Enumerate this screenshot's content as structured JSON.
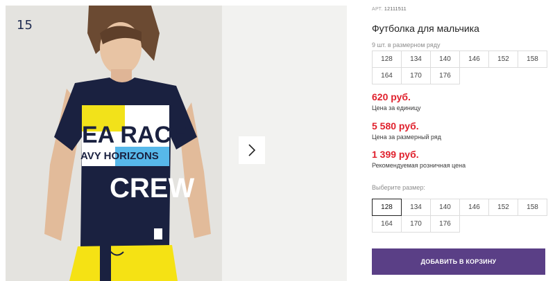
{
  "gallery": {
    "index_number": "15",
    "print_text": {
      "line1": "EA RACE",
      "line2": "AVY HORIZONS",
      "line3": "CREW"
    }
  },
  "product": {
    "art_label": "АРТ.",
    "art_value": "12111511",
    "title": "Футболка для мальчика",
    "row_note": "9 шт. в размерном ряду",
    "size_row": [
      "128",
      "134",
      "140",
      "146",
      "152",
      "158",
      "164",
      "170",
      "176"
    ]
  },
  "prices": {
    "unit_price": "620 руб.",
    "unit_caption": "Цена за единицу",
    "row_price": "5 580 руб.",
    "row_caption": "Цена за размерный ряд",
    "retail_price": "1 399 руб.",
    "retail_caption": "Рекомендуемая розничная цена"
  },
  "size_select": {
    "label": "Выберите размер:",
    "options": [
      "128",
      "134",
      "140",
      "146",
      "152",
      "158",
      "164",
      "170",
      "176"
    ],
    "selected": "128"
  },
  "cart_button": {
    "label": "ДОБАВИТЬ В КОРЗИНУ"
  },
  "colors": {
    "price_red": "#e0212d",
    "button_purple": "#5a3f86",
    "tshirt_navy": "#1a2140",
    "shorts_yellow": "#f5e214",
    "print_yellow": "#f2e21a",
    "print_blue": "#57b8ea"
  }
}
